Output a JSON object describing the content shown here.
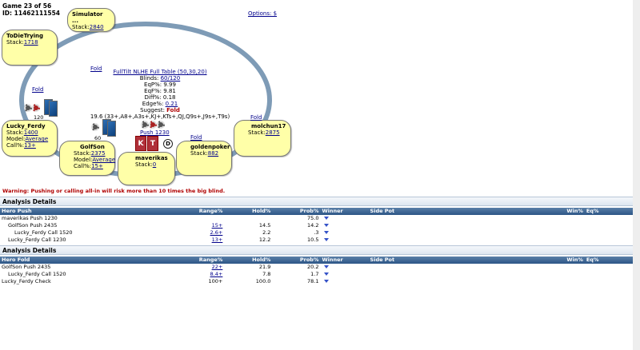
{
  "game": {
    "title": "Game 23 of 56",
    "id": "ID: 11462111554"
  },
  "options_link": "Options: $",
  "seats": [
    {
      "name": "Simulator ...",
      "stack_label": "Stack:",
      "stack": "2840"
    },
    {
      "name": "ToDieTrying",
      "stack_label": "Stack:",
      "stack": "1718"
    },
    {
      "name": "Lucky_Ferdy",
      "stack_label": "Stack:",
      "stack": "1400",
      "model_label": "Model:",
      "model": "Average",
      "call_label": "Call%:",
      "call": "13+"
    },
    {
      "name": "GolfSon",
      "stack_label": "Stack:",
      "stack": "2375",
      "model_label": "Model:",
      "model": "Average",
      "call_label": "Call%:",
      "call": "15+"
    },
    {
      "name": "maverikas",
      "stack_label": "Stack:",
      "stack": "0"
    },
    {
      "name": "goldenpoker",
      "stack_label": "Stack:",
      "stack": "882"
    },
    {
      "name": "molchun17",
      "stack_label": "Stack:",
      "stack": "2875"
    }
  ],
  "fold_label": "Fold",
  "hero_action": "Push 1230",
  "hole_cards": [
    "K",
    "T"
  ],
  "dealer_button": "D",
  "pots": {
    "left": "120",
    "mid": "60"
  },
  "info": {
    "table": "FullTilt NLHE Full Table (50,30,20)",
    "blinds_label": "Blinds:",
    "blinds": "60/120",
    "eqp": "EqP%: 9.99",
    "eqf": "EqF%: 9.81",
    "diff": "Diff%: 0.18",
    "edge_label": "Edge%:",
    "edge": "0.21",
    "suggest_label": "Suggest:",
    "suggest": "Fold",
    "range": "19.6 (33+,A8+,A3s+,KJ+,KTs+,QJ,Q9s+,J9s+,T9s)"
  },
  "warning": "Warning: Pushing or calling all-in will risk more than 10 times the big blind.",
  "analysis1": {
    "title": "Analysis Details",
    "headers": [
      "Hero Push",
      "Range%",
      "Hold%",
      "Prob%",
      "Winner",
      "Side Pot",
      "Win%",
      "Eq%"
    ],
    "rows": [
      {
        "label": "maverikas Push 1230",
        "range": "",
        "hold": "",
        "prob": "75.0",
        "indent": 0
      },
      {
        "label": "GolfSon Push 2435",
        "range": "15+",
        "hold": "14.5",
        "prob": "14.2",
        "indent": 1
      },
      {
        "label": "Lucky_Ferdy Call 1520",
        "range": "2.6+",
        "hold": "2.2",
        "prob": ".3",
        "indent": 2
      },
      {
        "label": "Lucky_Ferdy Call 1230",
        "range": "13+",
        "hold": "12.2",
        "prob": "10.5",
        "indent": 1
      }
    ]
  },
  "analysis2": {
    "title": "Analysis Details",
    "headers": [
      "Hero Fold",
      "Range%",
      "Hold%",
      "Prob%",
      "Winner",
      "Side Pot",
      "Win%",
      "Eq%"
    ],
    "rows": [
      {
        "label": "GolfSon Push 2435",
        "range": "22+",
        "hold": "21.9",
        "prob": "20.2",
        "indent": 0
      },
      {
        "label": "Lucky_Ferdy Call 1520",
        "range": "8.4+",
        "hold": "7.8",
        "prob": "1.7",
        "indent": 1
      },
      {
        "label": "Lucky_Ferdy Check",
        "range": "100+",
        "hold": "100.0",
        "prob": "78.1",
        "indent": 0,
        "range_plain": true
      }
    ]
  },
  "colors": {
    "table_oval": "#7e9bb6",
    "seat_bg": "#ffffa8",
    "warning": "#b00000",
    "header_bg": "#2d5686"
  }
}
